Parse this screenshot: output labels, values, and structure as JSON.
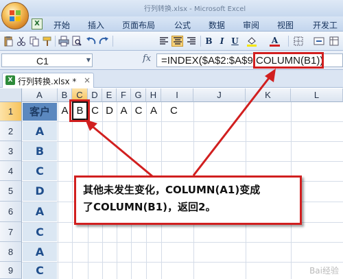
{
  "window": {
    "title": "行列转换.xlsx - Microsoft Excel"
  },
  "ribbon": {
    "quick_access_icon": "X",
    "tabs": [
      "开始",
      "插入",
      "页面布局",
      "公式",
      "数据",
      "审阅",
      "视图",
      "开发工具"
    ]
  },
  "toolbar": {
    "icons": [
      "paste-icon",
      "cut-icon",
      "copy-icon",
      "format-painter-icon",
      "print-icon",
      "print-preview-icon",
      "undo-icon",
      "redo-icon",
      "align-left-icon",
      "align-center-icon",
      "align-right-icon",
      "bold-icon",
      "italic-icon",
      "underline-icon",
      "fill-color-icon",
      "font-color-icon",
      "borders-icon",
      "merge-icon",
      "more-icon"
    ],
    "bold": "B",
    "italic": "I",
    "underline": "U",
    "font_color_letter": "A",
    "accent_red": "#d11f1f"
  },
  "formula_bar": {
    "name_box": "C1",
    "fx": "fx",
    "formula": "=INDEX($A$2:$A$9,COLUMN(B1))"
  },
  "workbook_tab": {
    "name": "行列转换.xlsx *",
    "close": "×"
  },
  "sheet": {
    "columns": [
      "A",
      "B",
      "C",
      "D",
      "E",
      "F",
      "G",
      "H",
      "I",
      "J",
      "K",
      "L"
    ],
    "rows": [
      "1",
      "2",
      "3",
      "4",
      "5",
      "6",
      "7",
      "8",
      "9"
    ],
    "active_cell": "C1",
    "column_a": [
      "客户",
      "A",
      "B",
      "C",
      "D",
      "A",
      "C",
      "A",
      "C"
    ],
    "row1": {
      "B": "A",
      "C": "B",
      "D": "C",
      "E": "D",
      "F": "A",
      "G": "C",
      "H": "A",
      "I": "C"
    }
  },
  "callout": {
    "line1": "其他未发生变化，COLUMN(A1)变成",
    "line2": "了COLUMN(B1)，返回2。"
  },
  "watermark": "Bai经验"
}
